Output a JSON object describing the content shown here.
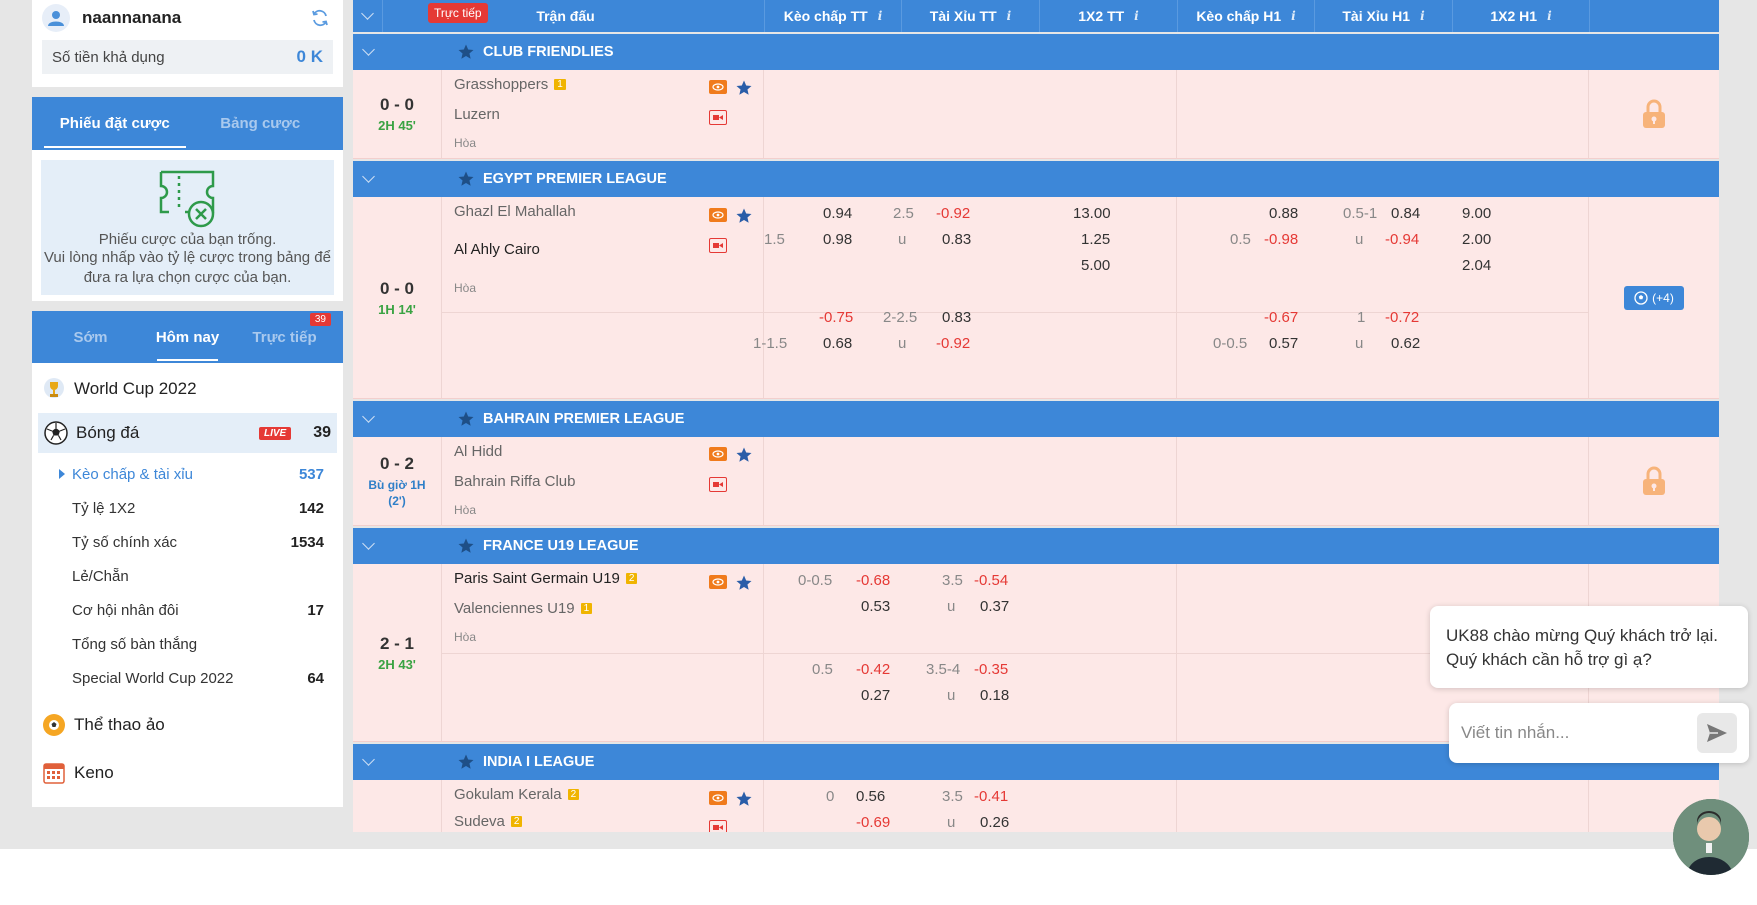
{
  "account": {
    "username": "naannanana",
    "balance_label": "Số tiền khả dụng",
    "balance_value": "0 K"
  },
  "bet_slip": {
    "tabs": [
      "Phiếu đặt cược",
      "Bảng cược"
    ],
    "empty_title": "Phiếu cược của bạn trống.",
    "empty_hint": "Vui lòng nhấp vào tỷ lệ cược trong bảng để đưa ra lựa chọn cược của bạn."
  },
  "sports_nav": {
    "tabs": [
      "Sớm",
      "Hôm nay",
      "Trực tiếp"
    ],
    "live_count": "39",
    "world_cup": "World Cup 2022",
    "football": {
      "label": "Bóng đá",
      "live_badge": "LIVE",
      "count": "39"
    },
    "subitems": [
      {
        "label": "Kèo chấp & tài xỉu",
        "count": "537"
      },
      {
        "label": "Tỷ lệ 1X2",
        "count": "142"
      },
      {
        "label": "Tỷ số chính xác",
        "count": "1534"
      },
      {
        "label": "Lẻ/Chẵn",
        "count": ""
      },
      {
        "label": "Cơ hội nhân đôi",
        "count": "17"
      },
      {
        "label": "Tổng số bàn thắng",
        "count": ""
      },
      {
        "label": "Special World Cup 2022",
        "count": "64"
      }
    ],
    "virtual": "Thể thao ảo",
    "keno": "Keno"
  },
  "table_header": {
    "live_tab": "Trực tiếp",
    "match": "Trận đấu",
    "hdp_ft": "Kèo chấp TT",
    "ou_ft": "Tài Xỉu TT",
    "x12_ft": "1X2 TT",
    "hdp_h1": "Kèo chấp H1",
    "ou_h1": "Tài Xỉu H1",
    "x12_h1": "1X2 H1",
    "info": "i"
  },
  "draw_label": "Hòa",
  "leagues": {
    "l1": "CLUB FRIENDLIES",
    "l2": "EGYPT PREMIER LEAGUE",
    "l3": "BAHRAIN PREMIER LEAGUE",
    "l4": "FRANCE U19 LEAGUE",
    "l5": "INDIA I LEAGUE"
  },
  "matches": {
    "m1": {
      "score": "0 - 0",
      "time": "2H 45'",
      "home": "Grasshoppers",
      "home_rc": "1",
      "away": "Luzern"
    },
    "m2": {
      "score": "0 - 0",
      "time": "1H 14'",
      "home": "Ghazl El Mahallah",
      "away": "Al Ahly Cairo",
      "more": "(+4)",
      "r1": {
        "hdp_l1": "",
        "hdp_o1": "0.94",
        "hdp_l2": "1.5",
        "hdp_o2": "0.98",
        "ou_l1": "2.5",
        "ou_o1": "-0.92",
        "ou_l2": "u",
        "ou_o2": "0.83",
        "x1": "13.00",
        "x2": "1.25",
        "x3": "5.00",
        "h1hdp_o1": "0.88",
        "h1hdp_l2": "0.5",
        "h1hdp_o2": "-0.98",
        "h1ou_l1": "0.5-1",
        "h1ou_o1": "0.84",
        "h1ou_l2": "u",
        "h1ou_o2": "-0.94",
        "h1x1": "9.00",
        "h1x2": "2.00",
        "h1x3": "2.04"
      },
      "r2": {
        "hdp_o1": "-0.75",
        "hdp_l2": "1-1.5",
        "hdp_o2": "0.68",
        "ou_l1": "2-2.5",
        "ou_o1": "0.83",
        "ou_l2": "u",
        "ou_o2": "-0.92",
        "h1hdp_o1": "-0.67",
        "h1hdp_l2": "0-0.5",
        "h1hdp_o2": "0.57",
        "h1ou_l1": "1",
        "h1ou_o1": "-0.72",
        "h1ou_l2": "u",
        "h1ou_o2": "0.62"
      }
    },
    "m3": {
      "score": "0 - 2",
      "time": "Bù giờ 1H (2')",
      "home": "Al Hidd",
      "away": "Bahrain Riffa Club"
    },
    "m4": {
      "score": "2 - 1",
      "time": "2H 43'",
      "home": "Paris Saint Germain U19",
      "home_rc": "2",
      "away": "Valenciennes U19",
      "away_rc": "1",
      "r1": {
        "hdp_l1": "0-0.5",
        "hdp_o1": "-0.68",
        "hdp_o2": "0.53",
        "ou_l1": "3.5",
        "ou_o1": "-0.54",
        "ou_l2": "u",
        "ou_o2": "0.37"
      },
      "r2": {
        "hdp_l1": "0.5",
        "hdp_o1": "-0.42",
        "hdp_o2": "0.27",
        "ou_l1": "3.5-4",
        "ou_o1": "-0.35",
        "ou_l2": "u",
        "ou_o2": "0.18"
      }
    },
    "m5": {
      "home": "Gokulam Kerala",
      "home_rc": "2",
      "away": "Sudeva",
      "away_rc": "2",
      "hdp_l1": "0",
      "hdp_o1": "0.56",
      "hdp_o2": "-0.69",
      "ou_l1": "3.5",
      "ou_o1": "-0.41",
      "ou_l2": "u",
      "ou_o2": "0.26"
    }
  },
  "chat": {
    "greeting": "UK88 chào mừng Quý khách trở lại. Quý khách cần hỗ trợ gì ạ?",
    "placeholder": "Viết tin nhắn..."
  },
  "colors": {
    "primary": "#3d87d8",
    "row_bg": "#fde8e7",
    "negative": "#e53935",
    "live_green": "#3aa343"
  }
}
